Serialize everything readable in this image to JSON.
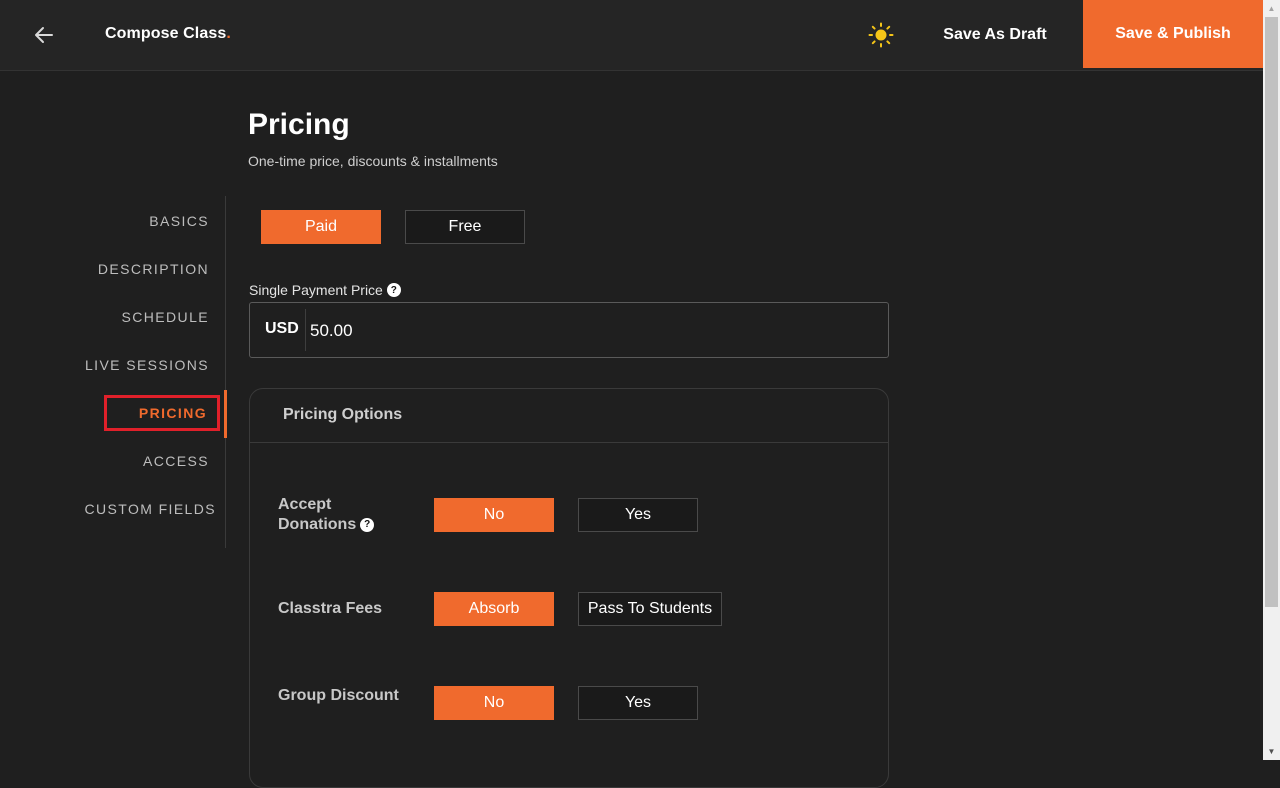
{
  "header": {
    "title": "Compose Class",
    "title_dot": ".",
    "save_draft_label": "Save As Draft",
    "publish_label": "Save & Publish",
    "back_icon": "arrow-left-icon",
    "theme_icon": "sun-icon"
  },
  "page": {
    "title": "Pricing",
    "subtitle": "One-time price, discounts & installments"
  },
  "sidebar": {
    "items": [
      {
        "label": "BASICS"
      },
      {
        "label": "DESCRIPTION"
      },
      {
        "label": "SCHEDULE"
      },
      {
        "label": "LIVE SESSIONS"
      },
      {
        "label": "PRICING",
        "active": true
      },
      {
        "label": "ACCESS"
      },
      {
        "label": "CUSTOM FIELDS"
      }
    ]
  },
  "pricing_type": {
    "paid_label": "Paid",
    "free_label": "Free",
    "selected": "Paid"
  },
  "single_price": {
    "label": "Single Payment Price",
    "currency": "USD",
    "value": "50.00"
  },
  "pricing_options": {
    "title": "Pricing Options",
    "accept_donations": {
      "label_line1": "Accept",
      "label_line2": "Donations",
      "no_label": "No",
      "yes_label": "Yes",
      "selected": "No"
    },
    "classtra_fees": {
      "label": "Classtra Fees",
      "absorb_label": "Absorb",
      "pass_label": "Pass To Students",
      "selected": "Absorb"
    },
    "group_discount": {
      "label": "Group Discount",
      "no_label": "No",
      "yes_label": "Yes",
      "selected": "No"
    }
  },
  "colors": {
    "accent": "#f06a2d",
    "background": "#1f1f1f",
    "highlight_box": "#e0202a"
  }
}
